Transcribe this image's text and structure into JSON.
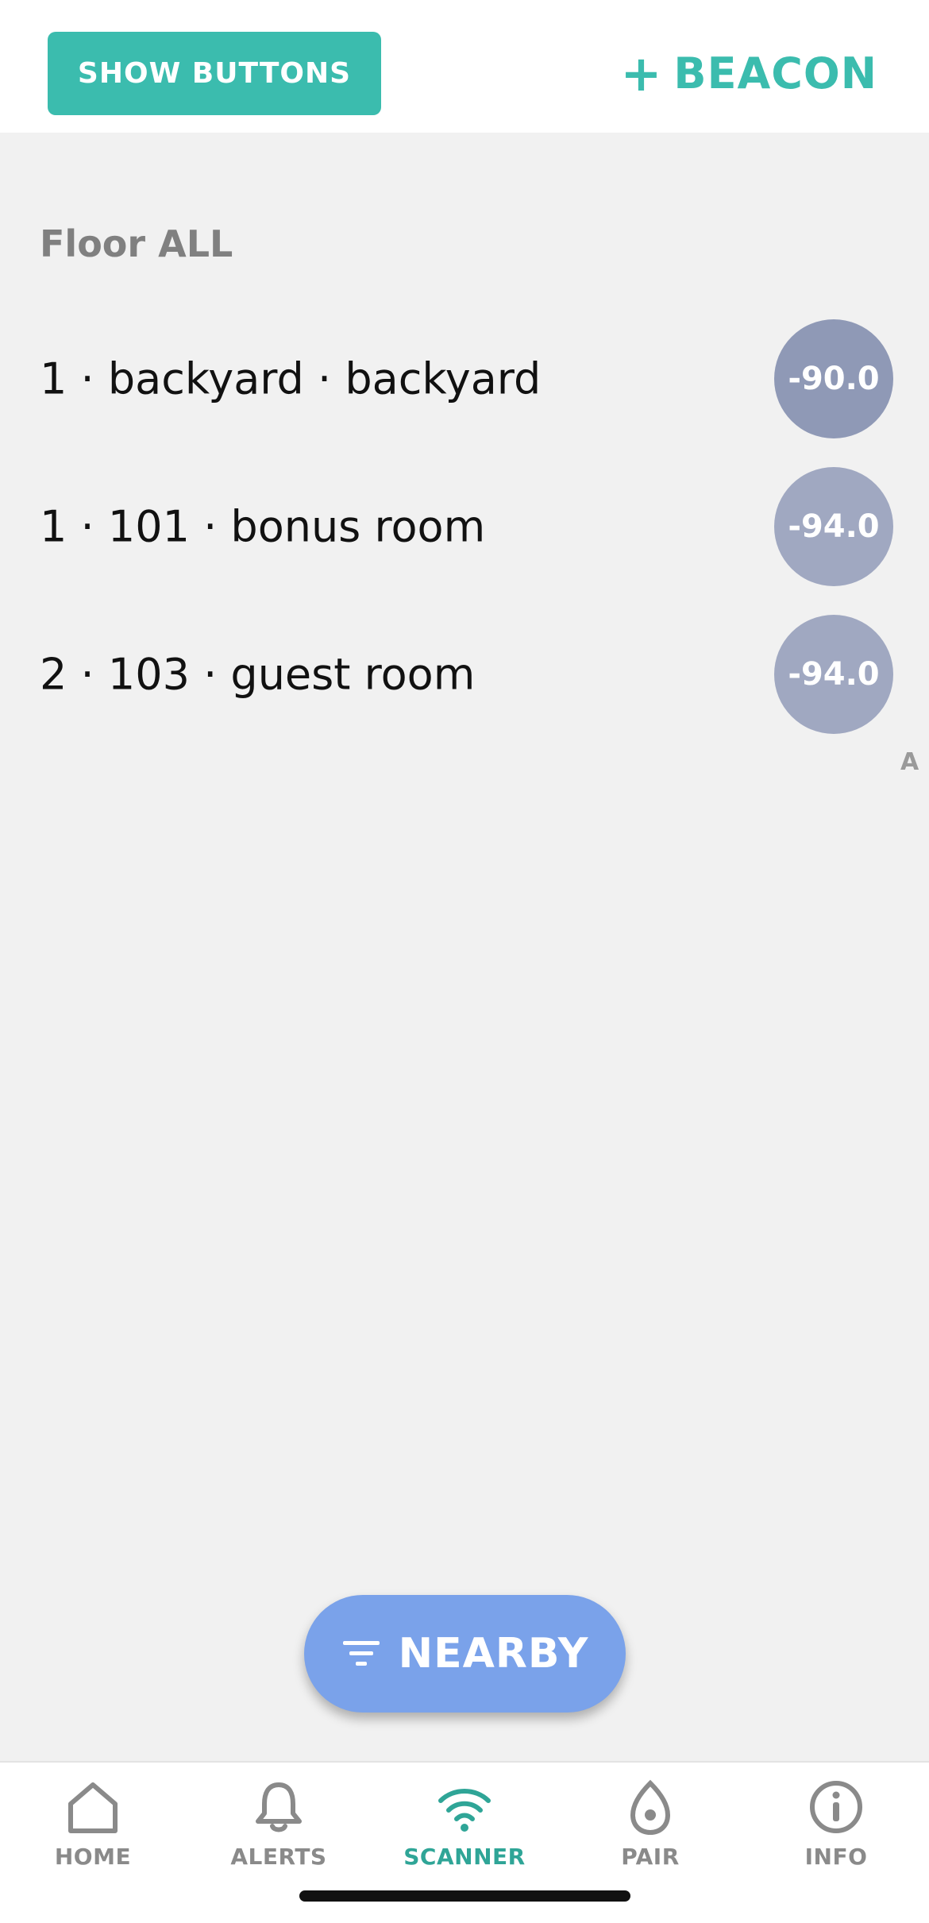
{
  "header": {
    "show_buttons_label": "SHOW BUTTONS",
    "add_beacon_plus": "+",
    "add_beacon_label": "BEACON"
  },
  "floor_title": "Floor ALL",
  "beacons": [
    {
      "label": "1 · backyard · backyard",
      "rssi": "-90.0",
      "color": "#8f99b6"
    },
    {
      "label": "1 · 101 · bonus room",
      "rssi": "-94.0",
      "color": "#a0a8c1"
    },
    {
      "label": "2 · 103 · guest room",
      "rssi": "-94.0",
      "color": "#a0a8c1"
    }
  ],
  "index_letter": "A",
  "nearby_label": "NEARBY",
  "nav": {
    "home": "HOME",
    "alerts": "ALERTS",
    "scanner": "SCANNER",
    "pair": "PAIR",
    "info": "INFO",
    "active": "scanner"
  },
  "colors": {
    "accent": "#3bbcae",
    "nav_active": "#2fa597",
    "nearby": "#7aa2ea"
  }
}
